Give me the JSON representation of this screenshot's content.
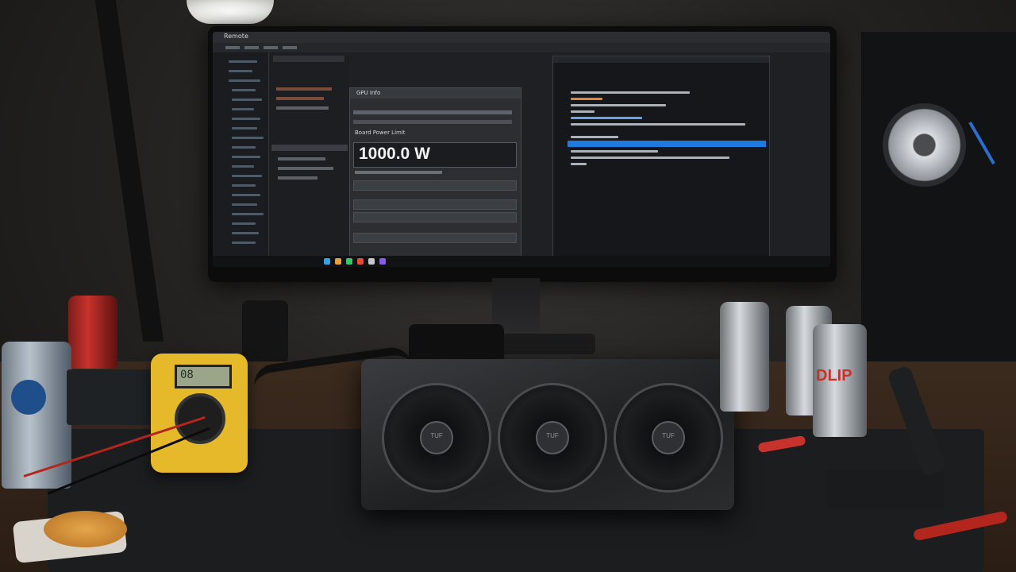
{
  "screen": {
    "window_title": "Remote",
    "dialog": {
      "title": "GPU Info",
      "section_label": "Board Power Limit",
      "power_value": "1000.0 W"
    }
  },
  "gpu": {
    "fan_logo": "TUF"
  },
  "multimeter": {
    "reading": "08"
  },
  "can": {
    "brand": "DLIP"
  },
  "colors": {
    "highlight": "#1f7ae0",
    "meter_body": "#e6b92a",
    "can_red": "#c8322d"
  }
}
